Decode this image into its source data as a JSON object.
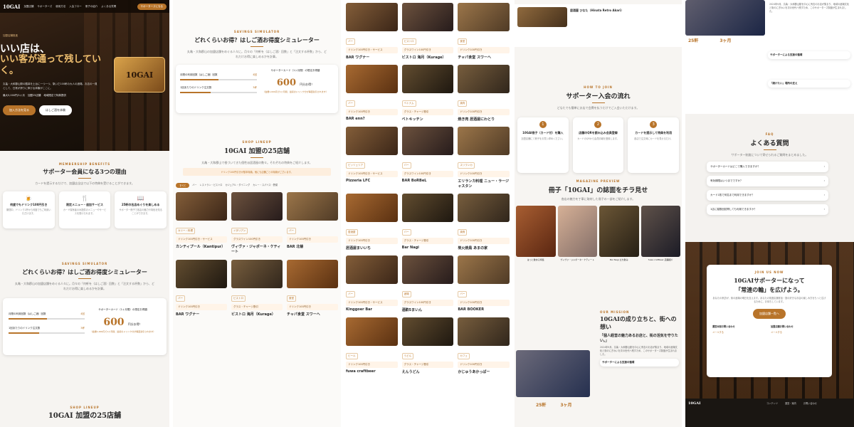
{
  "header": {
    "logo": "10GAI",
    "nav": [
      "加盟店舗",
      "サポーターズ",
      "使用方法",
      "入会フロー",
      "冊子の紹介",
      "よくある質問"
    ],
    "cta": "サポーターズになる"
  },
  "hero": {
    "eyebrow": "加盟店舗推進",
    "title_a": "いい店は、",
    "title_b": "いい客が通って残していく。",
    "desc": "丸亀・大和郡山駅の酸鼻を土台に一つ一つ、繋いだ100軒の大人の酒場。お店の一員として、日常が誇りに伸びる体験がここに。",
    "badge_logo": "10GAI",
    "chips": [
      "最大5,000円/1ヶ月",
      "加盟25店舗",
      "地域限定で特典提供"
    ],
    "btn_primary": "加入方法を見る",
    "btn_secondary": "はしご酒を体験"
  },
  "reasons": {
    "eyebrow": "MEMBERSHIP BENEFITS",
    "title": "サポーター会員になる3つの理由",
    "sub": "カードを提示するだけで、加盟店全店で以下の特典を受けることができます。",
    "items": [
      {
        "icon": "beer-icon",
        "title": "何度でもドリンク100円引き",
        "desc": "期間中、ドリンク1杯から何度でもご利用いただけます。"
      },
      {
        "icon": "cutlery-icon",
        "title": "限定メニュー・追加サービス",
        "desc": "カード保有者のみ提供のメニューやサービスを受けられます。"
      },
      {
        "icon": "book-icon",
        "title": "25軒の名店めぐりを楽しめる",
        "desc": "サポーター冊子で各店の魅力や特色を知ることができます。"
      }
    ]
  },
  "simulator": {
    "eyebrow": "SAVINGS SIMULATOR",
    "title": "どれくらいお得？はしご酒お得度シミュレーター",
    "sub": "丸亀・大和郡山の加盟店舗をめぐる人々に。月々の「何軒を（はしご酒）回数」と「注文する杯数」から、どれだけお得に楽しめるかを計算。",
    "slider1_label": "月間の利用回数（はしご酒）回数",
    "slider1_value": "4回",
    "slider2_label": "1回あたりのドリンク注文数",
    "slider2_value": "3杯",
    "result_label": "サポーターカード（1ヶ月間）の想定お得額",
    "result_value": "600",
    "result_unit": "円分お得！",
    "result_note": "（会費1,000円で1ヶ月間、最初のドリンク分が毎回割引されます）"
  },
  "lineup": {
    "eyebrow": "SHOP LINEUP",
    "title": "10GAI 加盟の25店舗",
    "sub": "丸亀・大和郡山で根づいてきた個性派居酒屋の数々。それぞれの特典をご紹介します。",
    "notice": "ドリンク100円引きが基本特典。他にも店舗ごとの特典がございます。",
    "filters": [
      "すべて",
      "バー",
      "レストラン・ビストロ",
      "カジュアル・ダイニング",
      "カレー・スパイス・野菜"
    ]
  },
  "shops_a": [
    {
      "name": "カンティプール（Kantipur）",
      "tag": "カリー・料理",
      "perk": "ドリンク100円引き・サービス"
    },
    {
      "name": "ヴィヴァ・ジャポーネ・ケティート",
      "tag": "イタリアン",
      "perk": "グラスワイン100円引き"
    },
    {
      "name": "BAR 北條",
      "tag": "バー",
      "perk": "ドリンク100円引き"
    },
    {
      "name": "BAR ワグナー",
      "tag": "バー",
      "perk": "ドリンク100円引き"
    },
    {
      "name": "ビストロ 海月（Kurage）",
      "tag": "ビストロ",
      "perk": "グラス・チャージ割引"
    },
    {
      "name": "チャパ食堂 スワーヘ",
      "tag": "食堂",
      "perk": "ドリンク100円引き"
    }
  ],
  "shops_b": [
    {
      "name": "BAR ワグナー",
      "tag": "バー"
    },
    {
      "name": "ビストロ 海月（Kurage）",
      "tag": "ビストロ"
    },
    {
      "name": "チャパ食堂 スワーヘ",
      "tag": "食堂"
    },
    {
      "name": "BAR enn?",
      "tag": "バー"
    },
    {
      "name": "ベトキッチン",
      "tag": "ベトナム"
    },
    {
      "name": "焼き肉 居酒屋にわとり",
      "tag": "焼肉"
    },
    {
      "name": "Pizzeria LFC",
      "tag": "ピッツェリア"
    },
    {
      "name": "BAR BoRBeL",
      "tag": "バー"
    },
    {
      "name": "エリランカ料理 ニュー・ラージャスタン",
      "tag": "スリランカ"
    },
    {
      "name": "居酒屋まいいち",
      "tag": "居酒屋"
    },
    {
      "name": "Bar Nagi",
      "tag": "バー"
    },
    {
      "name": "炭火焼鳥 あまの家",
      "tag": "焼鳥"
    },
    {
      "name": "Kinggoer Bar",
      "tag": "バー"
    },
    {
      "name": "酒酔5まいん",
      "tag": "酒場"
    },
    {
      "name": "BAR BOOKER",
      "tag": "バー"
    },
    {
      "name": "fuwa craftbeer",
      "tag": "ビール"
    },
    {
      "name": "えんうどん",
      "tag": "うどん"
    },
    {
      "name": "かじゅうあかっぱー",
      "tag": "カフェ"
    }
  ],
  "flow": {
    "shop_last": "居酒屋 ひなた（Hinata Retro Akari）",
    "eyebrow": "HOW TO JOIN",
    "title": "サポーター入会の流れ",
    "sub": "どなたでも簡単にお店で会費を払うだけでご入会いただけます。",
    "steps": [
      {
        "n": "1",
        "title": "10GAI冊子（カード付）を購入",
        "desc": "加盟店舗にて冊子をお買い求めください。"
      },
      {
        "n": "2",
        "title": "店舗のQRを読み込み会員登録",
        "desc": "カードのQRから会員情報を登録します。"
      },
      {
        "n": "3",
        "title": "カードを提示して特典を利用",
        "desc": "各店で注文時にカードを見せるだけ。"
      }
    ]
  },
  "magazine": {
    "eyebrow": "MAGAZINE PREVIEW",
    "title": "冊子「10GAI」の誌面をチラ見せ",
    "sub": "各店の魅力を丁寧に取材した冊子の一部をご紹介します。",
    "pages": [
      "はっと飲める特集",
      "ヴィヴァ・ジャポーネ・ケティート",
      "Bar Nagi 立ち飲み",
      "fuwa craftbeer 店舗紹介"
    ]
  },
  "story": {
    "eyebrow": "OUR MISSION",
    "title": "10GAIの成り立ちと、街への想い",
    "quote": "「個人経営の魅力あるお店と、街の活気を守りたい。」",
    "body": "2024年9月、丸亀・大和郡山駅を中心に有志のお店が集まり、地域の酒場文化と街のにぎわいを次の世代へ残すため、このサポーターズ制度が生まれました。",
    "years": [
      "25軒",
      "3ヶ月"
    ],
    "checks": [
      "サポーターによる支援の循環",
      "「続けたい」場所の支え"
    ]
  },
  "faq": {
    "eyebrow": "FAQ",
    "title": "よくある質問",
    "sub": "サポーター制度について寄せられるご質問をまとめました。",
    "items": [
      "サポーターカードはどこで購入できますか？",
      "有効期限はいつまでですか？",
      "カード1枚で何名まで利用できますか？",
      "1店に複数回訪問しても利用できますか？"
    ]
  },
  "join": {
    "eyebrow": "JOIN US NOW",
    "title_a": "10GAIサポーターになって",
    "title_b": "「常連の輪」を広げよう。",
    "sub": "あなたの来訪が、街の酒場の明日を支えます。あなたの常連応援参加・旅の好きなお店の楽しみ方をもっと広げるために、お待ちしています。",
    "cta": "加盟店舗一覧へ",
    "contact_a": "運営本部お問い合わせ",
    "contact_b": "加盟店舗お問い合わせ",
    "link": "メールする"
  },
  "footer": {
    "logo": "10GAI",
    "cols": [
      "コンテンツ",
      "運営・案内",
      "お問い合わせ"
    ]
  }
}
